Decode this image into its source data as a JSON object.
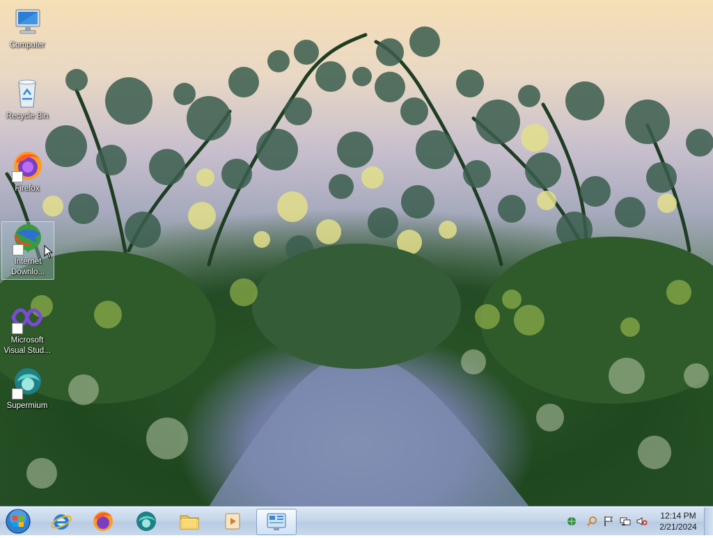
{
  "desktop": {
    "icons": [
      {
        "label": "Computer",
        "icon": "computer-icon"
      },
      {
        "label": "Recycle Bin",
        "icon": "recycle-bin-icon"
      },
      {
        "label": "Firefox",
        "icon": "firefox-icon"
      },
      {
        "label": "Internet Downlo...",
        "icon": "internet-download-manager-icon"
      },
      {
        "label": "Microsoft Visual Stud...",
        "icon": "visual-studio-icon"
      },
      {
        "label": "Supermium",
        "icon": "supermium-icon"
      }
    ]
  },
  "taskbar": {
    "pinned": [
      {
        "name": "internet-explorer",
        "icon": "internet-explorer-icon"
      },
      {
        "name": "firefox",
        "icon": "firefox-icon"
      },
      {
        "name": "supermium",
        "icon": "supermium-icon"
      },
      {
        "name": "file-explorer",
        "icon": "folder-icon"
      },
      {
        "name": "media-player",
        "icon": "media-player-icon"
      },
      {
        "name": "control-panel",
        "icon": "control-panel-icon"
      }
    ],
    "clock": {
      "time": "12:14 PM",
      "date": "2/21/2024"
    }
  },
  "colors": {
    "taskbar_top": "#dbe6f3",
    "taskbar_bottom": "#c9d9ec",
    "start_orb": "#2f7fd3"
  }
}
